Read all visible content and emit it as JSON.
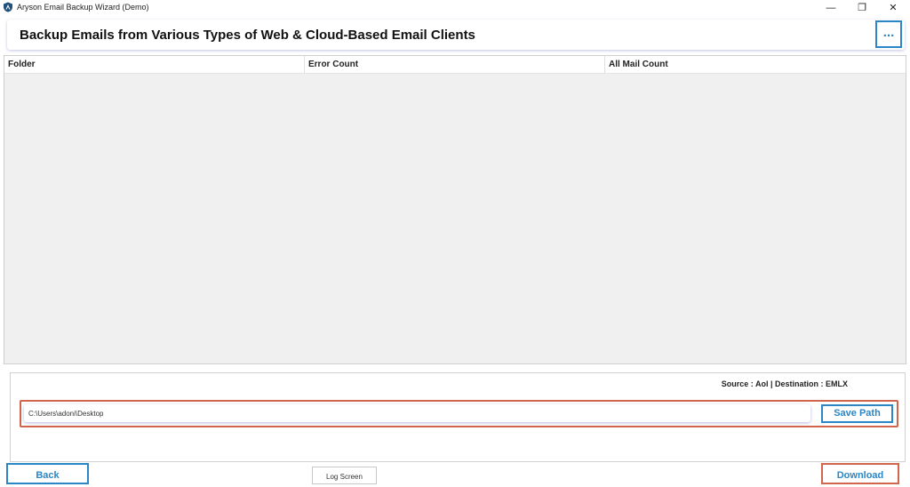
{
  "window": {
    "title": "Aryson Email Backup Wizard (Demo)",
    "controls": {
      "minimize": "—",
      "restore": "❐",
      "close": "✕"
    }
  },
  "header": {
    "title": "Backup Emails from Various Types of Web & Cloud-Based Email Clients",
    "more_label": "..."
  },
  "grid": {
    "columns": [
      "Folder",
      "Error Count",
      "All Mail Count"
    ],
    "rows": []
  },
  "destination": {
    "source_info": "Source : Aol | Destination : EMLX",
    "path_value": "C:\\Users\\adoni\\Desktop",
    "save_path_label": "Save Path"
  },
  "footer": {
    "back_label": "Back",
    "log_label": "Log Screen",
    "download_label": "Download"
  },
  "colors": {
    "accent": "#2b86c5",
    "highlight": "#d0654b"
  }
}
